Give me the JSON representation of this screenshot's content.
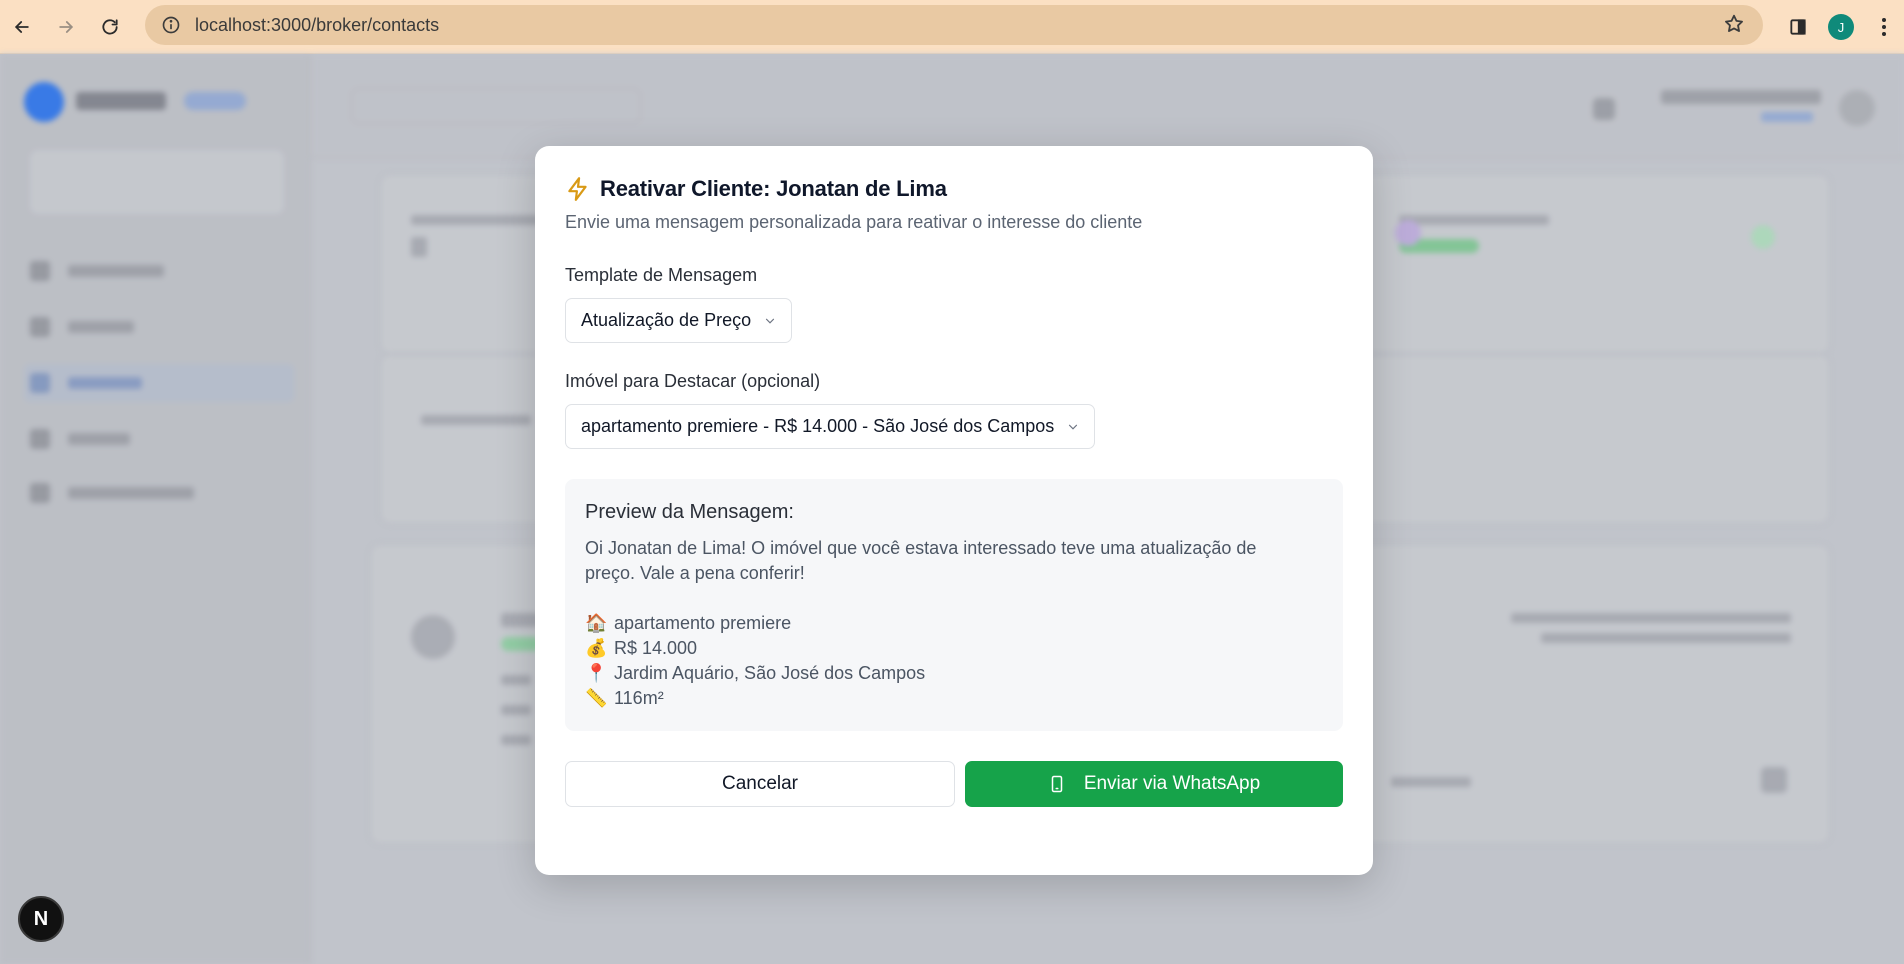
{
  "browser": {
    "url_host": "localhost",
    "url_path": ":3000/broker/contacts",
    "profile_initial": "J"
  },
  "modal": {
    "title_prefix": "Reativar Cliente: ",
    "title_name": "Jonatan de Lima",
    "subtitle": "Envie uma mensagem personalizada para reativar o interesse do cliente",
    "template_label": "Template de Mensagem",
    "template_value": "Atualização de Preço",
    "property_label": "Imóvel para Destacar (opcional)",
    "property_value": "apartamento premiere - R$ 14.000 - São José dos Campos",
    "preview_title": "Preview da Mensagem:",
    "preview_message": "Oi Jonatan de Lima! O imóvel que você estava interessado teve uma atualização de preço. Vale a pena conferir!",
    "preview_lines": [
      {
        "icon": "🏠",
        "icon_name": "house-icon",
        "text": "apartamento premiere"
      },
      {
        "icon": "💰",
        "icon_name": "money-bag-icon",
        "text": "R$ 14.000"
      },
      {
        "icon": "📍",
        "icon_name": "location-pin-icon",
        "text": "Jardim Aquário, São José dos Campos"
      },
      {
        "icon": "📏",
        "icon_name": "ruler-icon",
        "text": "116m²"
      }
    ],
    "cancel_label": "Cancelar",
    "send_label": "Enviar via WhatsApp"
  },
  "next_badge": "N",
  "colors": {
    "accent_green": "#16a34a",
    "bolt": "#d99a16",
    "chrome_bar": "#fbe0c3"
  }
}
